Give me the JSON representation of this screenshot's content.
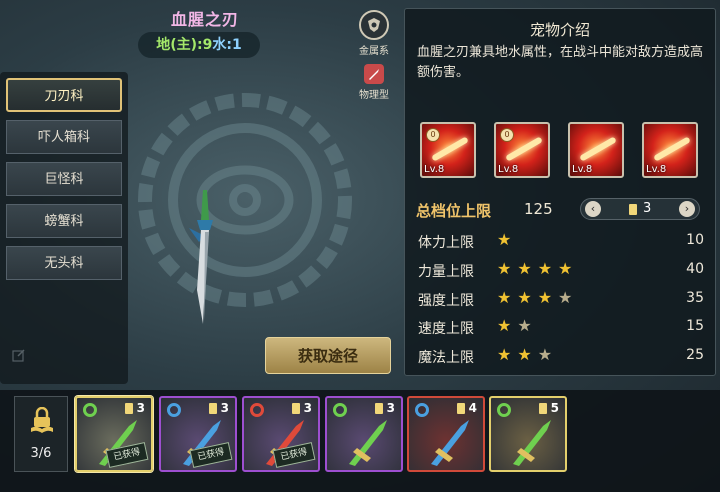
{
  "pet": {
    "name": "血腥之刃",
    "element_prefix_earth": "地(主)",
    "element_earth_value": ":9",
    "element_water_label": "水",
    "element_water_value": ":1"
  },
  "type_badges": {
    "attribute_label": "金属系",
    "attack_label": "物理型",
    "attribute_icon": "metal-crest-icon",
    "attack_icon": "sword-slash-icon"
  },
  "categories": {
    "items": [
      {
        "label": "刀刃科",
        "active": true
      },
      {
        "label": "吓人箱科",
        "active": false
      },
      {
        "label": "巨怪科",
        "active": false
      },
      {
        "label": "螃蟹科",
        "active": false
      },
      {
        "label": "无头科",
        "active": false
      }
    ]
  },
  "acquire_button": "获取途径",
  "intro": {
    "title": "宠物介绍",
    "text": "血腥之刃兼具地水属性，在战斗中能对敌方造成高额伤害。"
  },
  "skills": [
    {
      "level": "Lv.8",
      "rune": true
    },
    {
      "level": "Lv.8",
      "rune": true
    },
    {
      "level": "Lv.8",
      "rune": false
    },
    {
      "level": "Lv.8",
      "rune": false
    }
  ],
  "total": {
    "label": "总档位上限",
    "value": "125",
    "grade_value": "3",
    "prev_icon": "chevron-left-icon",
    "next_icon": "chevron-right-icon"
  },
  "stats": [
    {
      "label": "体力上限",
      "stars": 1,
      "value": "10"
    },
    {
      "label": "力量上限",
      "stars": 4,
      "value": "40"
    },
    {
      "label": "强度上限",
      "stars": 3.5,
      "value": "35"
    },
    {
      "label": "速度上限",
      "stars": 1.5,
      "value": "15"
    },
    {
      "label": "魔法上限",
      "stars": 2.5,
      "value": "25"
    }
  ],
  "lock": {
    "icon": "lock-book-icon",
    "count": "3/6"
  },
  "evolution_slots": [
    {
      "count": "3",
      "status": "已获得",
      "border_color": "#e3cf6c",
      "bg": "#6b6d5e",
      "ring": "#6fd04f",
      "selected": true
    },
    {
      "count": "3",
      "status": "已获得",
      "border_color": "#9d4fd0",
      "bg": "#5a4a72",
      "ring": "#4aa0e0",
      "selected": false
    },
    {
      "count": "3",
      "status": "已获得",
      "border_color": "#9d4fd0",
      "bg": "#5a4a72",
      "ring": "#e04a3a",
      "selected": false
    },
    {
      "count": "3",
      "status": "",
      "border_color": "#9d4fd0",
      "bg": "#5a4a72",
      "ring": "#6fd04f",
      "selected": false
    },
    {
      "count": "4",
      "status": "",
      "border_color": "#d04a3a",
      "bg": "#6e3232",
      "ring": "#4aa0e0",
      "selected": false
    },
    {
      "count": "5",
      "status": "",
      "border_color": "#e3cf6c",
      "bg": "#6b6044",
      "ring": "#6fd04f",
      "selected": false
    }
  ]
}
